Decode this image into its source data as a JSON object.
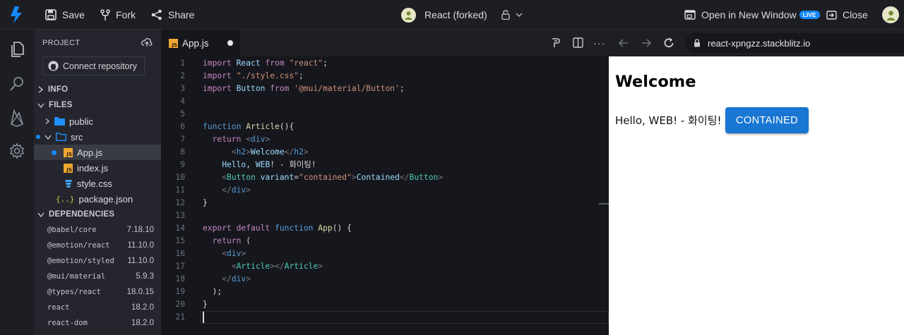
{
  "topbar": {
    "save_label": "Save",
    "fork_label": "Fork",
    "share_label": "Share",
    "project_title": "React (forked)",
    "open_window_label": "Open in New Window",
    "live_badge": "LIVE",
    "close_label": "Close"
  },
  "sidebar": {
    "header": "PROJECT",
    "connect_label": "Connect repository",
    "info_section": "INFO",
    "files_section": "FILES",
    "files": [
      {
        "name": "public"
      },
      {
        "name": "src"
      },
      {
        "name": "App.js"
      },
      {
        "name": "index.js"
      },
      {
        "name": "style.css"
      },
      {
        "name": "package.json"
      }
    ],
    "deps_section": "DEPENDENCIES",
    "dependencies": [
      {
        "name": "@babel/core",
        "version": "7.18.10"
      },
      {
        "name": "@emotion/react",
        "version": "11.10.0"
      },
      {
        "name": "@emotion/styled",
        "version": "11.10.0"
      },
      {
        "name": "@mui/material",
        "version": "5.9.3"
      },
      {
        "name": "@types/react",
        "version": "18.0.15"
      },
      {
        "name": "react",
        "version": "18.2.0"
      },
      {
        "name": "react-dom",
        "version": "18.2.0"
      }
    ]
  },
  "editor": {
    "tab_label": "App.js",
    "tab_badge": "JS",
    "code": [
      "import React from \"react\";",
      "import \"./style.css\";",
      "import Button from '@mui/material/Button';",
      "",
      "",
      "function Article(){",
      "  return <div>",
      "      <h2>Welcome</h2>",
      "    Hello, WEB! - 화이팅!",
      "    <Button variant=\"contained\">Contained</Button>",
      "    </div>",
      "}",
      "",
      "export default function App() {",
      "  return (",
      "    <div>",
      "      <Article></Article>",
      "    </div>",
      "  );",
      "}",
      ""
    ]
  },
  "preview": {
    "url": "react-xpngzz.stackblitz.io",
    "heading": "Welcome",
    "text": "Hello, WEB! - 화이팅!",
    "button_label": "CONTAINED"
  },
  "colors": {
    "accent": "#1389fd",
    "mui_primary": "#1976d2",
    "js_badge": "#f0a732"
  }
}
